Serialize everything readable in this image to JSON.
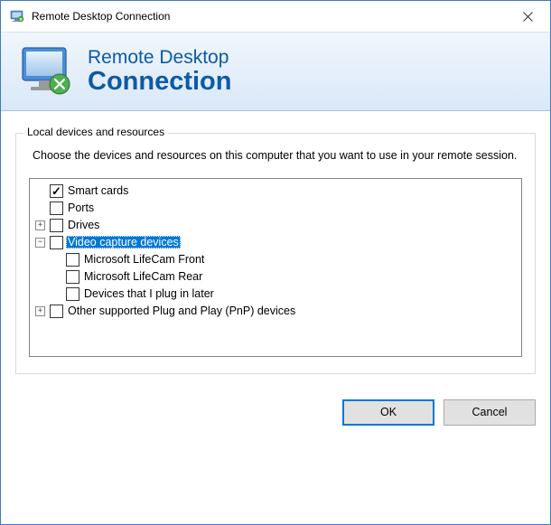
{
  "window": {
    "title": "Remote Desktop Connection"
  },
  "banner": {
    "line1": "Remote Desktop",
    "line2": "Connection"
  },
  "group": {
    "title": "Local devices and resources",
    "instructions": "Choose the devices and resources on this computer that you want to use in your remote session."
  },
  "tree": {
    "items": {
      "smart_cards": {
        "label": "Smart cards",
        "checked": true
      },
      "ports": {
        "label": "Ports",
        "checked": false
      },
      "drives": {
        "label": "Drives",
        "checked": false,
        "expander": "+"
      },
      "video": {
        "label": "Video capture devices",
        "checked": false,
        "selected": true,
        "expander": "−"
      },
      "video_children": {
        "front": {
          "label": "Microsoft LifeCam Front",
          "checked": false
        },
        "rear": {
          "label": "Microsoft LifeCam Rear",
          "checked": false
        },
        "later": {
          "label": "Devices that I plug in later",
          "checked": false
        }
      },
      "pnp": {
        "label": "Other supported Plug and Play (PnP) devices",
        "checked": false,
        "expander": "+"
      }
    }
  },
  "buttons": {
    "ok": "OK",
    "cancel": "Cancel"
  }
}
